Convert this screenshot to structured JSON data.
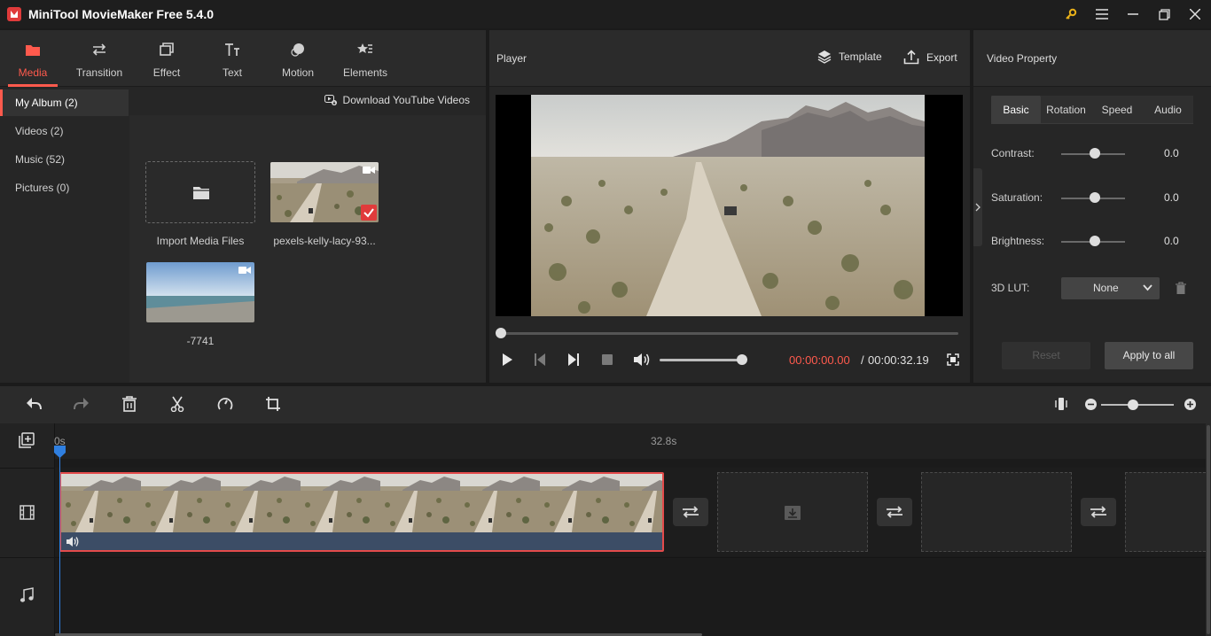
{
  "window": {
    "title": "MiniTool MovieMaker Free 5.4.0"
  },
  "tabs": [
    {
      "label": "Media",
      "icon": "folder-icon",
      "active": true
    },
    {
      "label": "Transition",
      "icon": "swap-icon"
    },
    {
      "label": "Effect",
      "icon": "effect-icon"
    },
    {
      "label": "Text",
      "icon": "text-icon"
    },
    {
      "label": "Motion",
      "icon": "motion-icon"
    },
    {
      "label": "Elements",
      "icon": "elements-icon"
    }
  ],
  "sidebar": {
    "items": [
      {
        "label": "My Album (2)",
        "active": true
      },
      {
        "label": "Videos (2)"
      },
      {
        "label": "Music (52)"
      },
      {
        "label": "Pictures (0)"
      }
    ]
  },
  "media": {
    "download_label": "Download YouTube Videos",
    "import_label": "Import Media Files",
    "items": [
      {
        "label": "pexels-kelly-lacy-93...",
        "selected": true
      },
      {
        "label": "-7741",
        "selected": false
      }
    ]
  },
  "player": {
    "title": "Player",
    "template_label": "Template",
    "export_label": "Export",
    "time_current": "00:00:00.00",
    "time_separator": "/",
    "time_total": "00:00:32.19",
    "volume_level": 0.9,
    "progress": 0
  },
  "property": {
    "title": "Video Property",
    "tabs": [
      "Basic",
      "Rotation",
      "Speed",
      "Audio"
    ],
    "active_tab": "Basic",
    "contrast_label": "Contrast:",
    "contrast_value": "0.0",
    "saturation_label": "Saturation:",
    "saturation_value": "0.0",
    "brightness_label": "Brightness:",
    "brightness_value": "0.0",
    "lut_label": "3D LUT:",
    "lut_value": "None",
    "reset_label": "Reset",
    "apply_label": "Apply to all"
  },
  "timeline": {
    "ruler_start": "0s",
    "ruler_end": "32.8s"
  },
  "colors": {
    "accent": "#ff5a4d",
    "playhead": "#2f7fe0",
    "clip_border": "#e34b4b",
    "clip_audio": "#3c4d66"
  }
}
